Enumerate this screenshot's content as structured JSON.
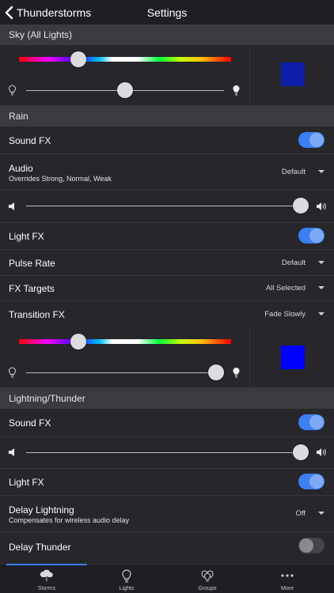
{
  "nav": {
    "back_label": "Thunderstorms",
    "title": "Settings"
  },
  "colors": {
    "accent": "#3d7ef0",
    "sky_swatch": "#0f1ea8",
    "rain_swatch": "#0000ff"
  },
  "sky": {
    "header": "Sky (All Lights)",
    "hue_position": 0.28,
    "brightness_level": 0.5
  },
  "rain": {
    "header": "Rain",
    "sound_fx": {
      "label": "Sound FX",
      "on": true
    },
    "audio": {
      "label": "Audio",
      "sub": "Overrides Strong, Normal, Weak",
      "value": "Default"
    },
    "volume_level": 1.0,
    "light_fx": {
      "label": "Light FX",
      "on": true
    },
    "pulse_rate": {
      "label": "Pulse Rate",
      "value": "Default"
    },
    "fx_targets": {
      "label": "FX Targets",
      "value": "All Selected"
    },
    "transition_fx": {
      "label": "Transition FX",
      "value": "Fade Slowly"
    },
    "hue_position": 0.28,
    "brightness_level": 0.96
  },
  "lightning": {
    "header": "Lightning/Thunder",
    "sound_fx": {
      "label": "Sound FX",
      "on": true
    },
    "volume_level": 1.0,
    "light_fx": {
      "label": "Light FX",
      "on": true
    },
    "delay_lightning": {
      "label": "Delay Lightning",
      "sub": "Compensates for wireless audio delay",
      "value": "Off"
    },
    "delay_thunder": {
      "label": "Delay Thunder",
      "on": false
    }
  },
  "tabs": [
    {
      "label": "Storms",
      "icon": "storm-cloud-icon",
      "active": true
    },
    {
      "label": "Lights",
      "icon": "lightbulb-icon",
      "active": false
    },
    {
      "label": "Groups",
      "icon": "bulb-group-icon",
      "active": false
    },
    {
      "label": "More",
      "icon": "ellipsis-icon",
      "active": false
    }
  ]
}
